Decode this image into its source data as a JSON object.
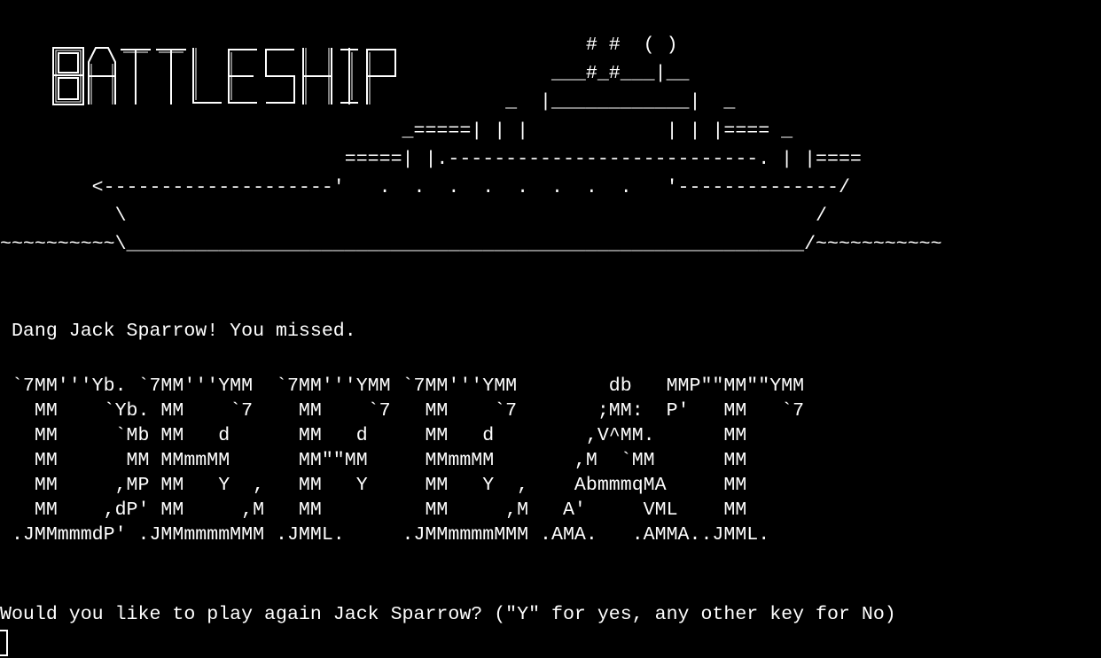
{
  "title_logo": "BATTLESHIP",
  "ship_art_lines": [
    "                                                   # #  ( )",
    "                                                ___#_#___|__",
    "                                            _  |____________|  _",
    "                                   _=====| | |            | | |==== _",
    "                              =====| |.---------------------------. | |====",
    "        <--------------------'   .  .  .  .  .  .  .  .   '--------------/",
    "          \\                                                            /",
    "~~~~~~~~~~\\___________________________________________________________/~~~~~~~~~~~"
  ],
  "message": " Dang Jack Sparrow! You missed.",
  "result_art_lines": [
    " `7MM'''Yb. `7MM'''YMM  `7MM'''YMM `7MM'''YMM        db   MMP\"\"MM\"\"YMM",
    "   MM    `Yb. MM    `7    MM    `7   MM    `7       ;MM:  P'   MM   `7",
    "   MM     `Mb MM   d      MM   d     MM   d        ,V^MM.      MM",
    "   MM      MM MMmmMM      MM\"\"MM     MMmmMM       ,M  `MM      MM",
    "   MM     ,MP MM   Y  ,   MM   Y     MM   Y  ,    AbmmmqMA     MM",
    "   MM    ,dP' MM     ,M   MM         MM     ,M   A'     VML    MM",
    " .JMMmmmdP' .JMMmmmmMMM .JMML.     .JMMmmmmMMM .AMA.   .AMMA..JMML."
  ],
  "prompt": "Would you like to play again Jack Sparrow? (\"Y\" for yes, any other key for No)",
  "colors": {
    "background": "#000000",
    "foreground": "#ffffff"
  }
}
